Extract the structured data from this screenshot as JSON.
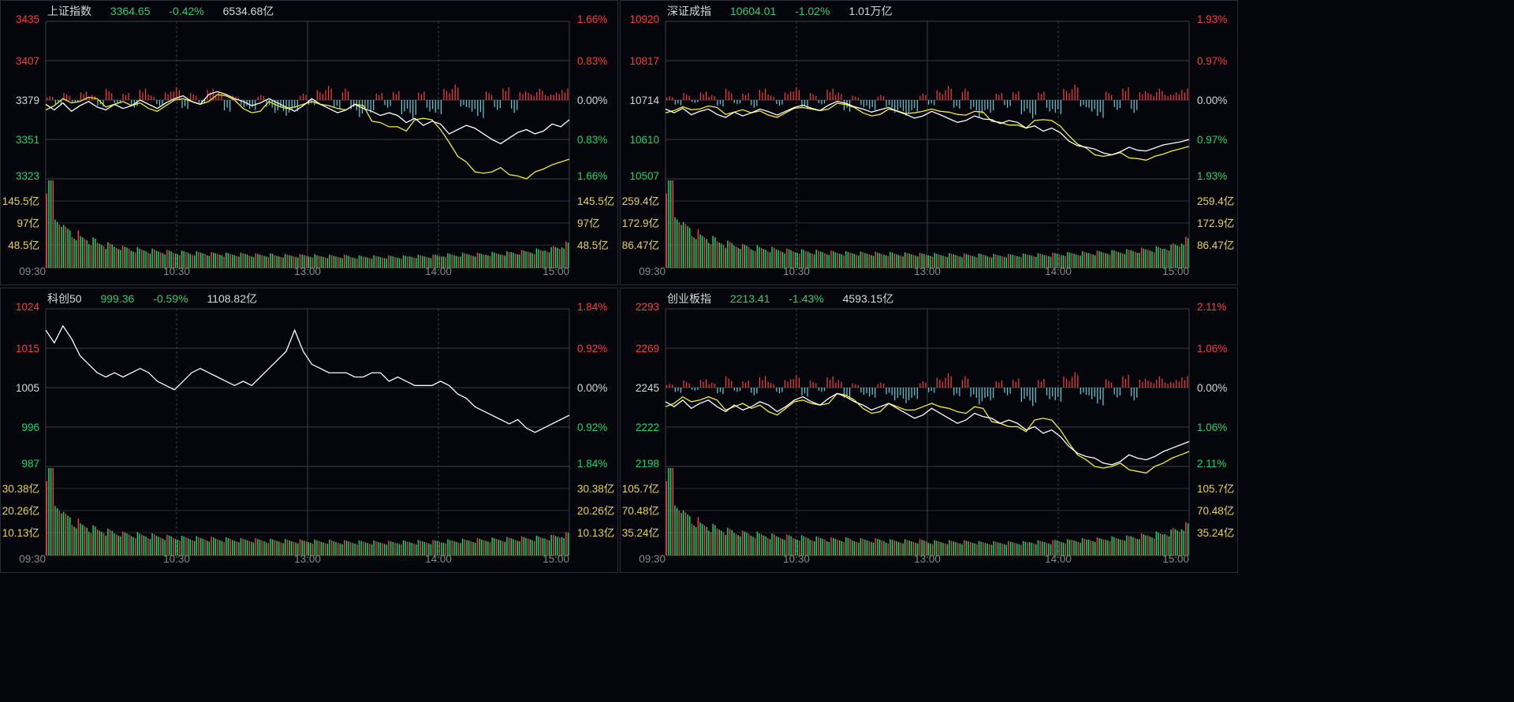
{
  "colors": {
    "up": "#ff3b3b",
    "down": "#16d86b",
    "neutral": "#d8d8d8",
    "avg_line": "#f2ee2a",
    "price_line": "#ffffff",
    "vol_label": "#e8d34a",
    "bar_neg": "#5fd3dc"
  },
  "time_ticks": [
    "09:30",
    "10:30",
    "13:00",
    "14:00",
    "15:00"
  ],
  "chart_data": [
    {
      "type": "line",
      "name": "上证指数",
      "price": "3364.65",
      "change": "-0.42%",
      "turnover": "6534.68亿",
      "price_axis": [
        {
          "label": "3435",
          "color": "up"
        },
        {
          "label": "3407",
          "color": "up"
        },
        {
          "label": "3379",
          "color": "neutral"
        },
        {
          "label": "3351",
          "color": "down"
        },
        {
          "label": "3323",
          "color": "down"
        }
      ],
      "pct_axis": [
        {
          "label": "1.66%",
          "color": "up"
        },
        {
          "label": "0.83%",
          "color": "up"
        },
        {
          "label": "0.00%",
          "color": "neutral"
        },
        {
          "label": "0.83%",
          "color": "down"
        },
        {
          "label": "1.66%",
          "color": "down"
        }
      ],
      "vol_axis": [
        "145.5亿",
        "97亿",
        "48.5亿"
      ],
      "ylim": [
        3323,
        3435
      ],
      "has_avg": true,
      "price_series": [
        3376,
        3372,
        3377,
        3371,
        3375,
        3378,
        3374,
        3372,
        3376,
        3373,
        3375,
        3379,
        3376,
        3373,
        3377,
        3380,
        3382,
        3378,
        3376,
        3383,
        3385,
        3383,
        3380,
        3378,
        3375,
        3377,
        3380,
        3377,
        3374,
        3371,
        3375,
        3380,
        3376,
        3373,
        3370,
        3372,
        3376,
        3373,
        3371,
        3368,
        3370,
        3368,
        3363,
        3366,
        3361,
        3364,
        3362,
        3355,
        3358,
        3361,
        3359,
        3355,
        3351,
        3348,
        3352,
        3356,
        3358,
        3355,
        3357,
        3362,
        3360,
        3365
      ],
      "avg_series": [
        3372,
        3375,
        3380,
        3377,
        3378,
        3381,
        3380,
        3374,
        3376,
        3378,
        3375,
        3377,
        3373,
        3371,
        3375,
        3379,
        3380,
        3378,
        3376,
        3378,
        3383,
        3382,
        3379,
        3373,
        3370,
        3371,
        3378,
        3375,
        3373,
        3374,
        3376,
        3378,
        3376,
        3375,
        3373,
        3372,
        3376,
        3375,
        3364,
        3363,
        3360,
        3360,
        3357,
        3365,
        3366,
        3365,
        3358,
        3349,
        3339,
        3335,
        3328,
        3327,
        3328,
        3331,
        3326,
        3325,
        3323,
        3328,
        3330,
        3333,
        3335,
        3337
      ],
      "dev_bars": [
        0.3,
        -0.4,
        0.5,
        -0.2,
        0.6,
        0.4,
        -0.5,
        0.8,
        -0.3,
        0.5,
        -0.6,
        0.9,
        0.4,
        -0.4,
        0.6,
        1.0,
        -0.7,
        0.5,
        -0.3,
        0.8,
        0.6,
        -0.9,
        0.3,
        -0.5,
        -0.7,
        0.4,
        -0.6,
        -0.9,
        -1.1,
        -0.8,
        0.5,
        -0.4,
        0.7,
        1.0,
        -0.6,
        0.9,
        -0.8,
        -1.2,
        -0.9,
        0.5,
        -0.6,
        0.7,
        -1.0,
        -1.3,
        0.6,
        -0.9,
        -1.1,
        0.8,
        1.1,
        -0.5,
        -0.9,
        -1.4,
        0.6,
        -0.7,
        0.9,
        -1.0,
        0.7,
        0.5,
        0.8,
        0.4,
        0.6,
        0.9
      ],
      "volume": [
        145,
        80,
        62,
        54,
        48,
        44,
        40,
        37,
        35,
        32,
        30,
        29,
        28,
        27,
        26,
        25,
        25,
        24,
        24,
        23,
        23,
        22,
        22,
        22,
        21,
        21,
        21,
        20,
        20,
        20,
        20,
        20,
        19,
        19,
        19,
        19,
        18,
        18,
        18,
        18,
        18,
        18,
        18,
        19,
        19,
        19,
        20,
        21,
        21,
        22,
        22,
        22,
        23,
        23,
        24,
        25,
        26,
        27,
        28,
        30,
        33,
        38
      ]
    },
    {
      "type": "line",
      "name": "深证成指",
      "price": "10604.01",
      "change": "-1.02%",
      "turnover": "1.01万亿",
      "price_axis": [
        {
          "label": "10920",
          "color": "up"
        },
        {
          "label": "10817",
          "color": "up"
        },
        {
          "label": "10714",
          "color": "neutral"
        },
        {
          "label": "10610",
          "color": "down"
        },
        {
          "label": "10507",
          "color": "down"
        }
      ],
      "pct_axis": [
        {
          "label": "1.93%",
          "color": "up"
        },
        {
          "label": "0.97%",
          "color": "up"
        },
        {
          "label": "0.00%",
          "color": "neutral"
        },
        {
          "label": "0.97%",
          "color": "down"
        },
        {
          "label": "1.93%",
          "color": "down"
        }
      ],
      "vol_axis": [
        "259.4亿",
        "172.9亿",
        "86.47亿"
      ],
      "ylim": [
        10507,
        10920
      ],
      "has_avg": true,
      "price_series": [
        10690,
        10680,
        10692,
        10675,
        10684,
        10690,
        10676,
        10668,
        10682,
        10672,
        10680,
        10690,
        10683,
        10674,
        10684,
        10694,
        10700,
        10692,
        10686,
        10700,
        10710,
        10705,
        10696,
        10690,
        10682,
        10688,
        10694,
        10684,
        10676,
        10666,
        10672,
        10684,
        10675,
        10665,
        10655,
        10660,
        10672,
        10664,
        10662,
        10652,
        10660,
        10655,
        10640,
        10646,
        10632,
        10640,
        10628,
        10606,
        10594,
        10590,
        10585,
        10575,
        10570,
        10578,
        10590,
        10582,
        10580,
        10588,
        10596,
        10600,
        10604,
        10610
      ],
      "avg_series": [
        10680,
        10686,
        10696,
        10688,
        10690,
        10698,
        10694,
        10676,
        10682,
        10688,
        10680,
        10685,
        10674,
        10668,
        10680,
        10692,
        10694,
        10690,
        10686,
        10690,
        10705,
        10702,
        10694,
        10680,
        10672,
        10676,
        10690,
        10685,
        10678,
        10680,
        10684,
        10690,
        10684,
        10682,
        10676,
        10674,
        10684,
        10682,
        10658,
        10655,
        10648,
        10648,
        10640,
        10660,
        10662,
        10660,
        10645,
        10620,
        10598,
        10588,
        10570,
        10566,
        10570,
        10576,
        10562,
        10560,
        10556,
        10566,
        10572,
        10580,
        10586,
        10592
      ],
      "dev_bars": [
        0.3,
        -0.4,
        0.5,
        -0.2,
        0.6,
        0.4,
        -0.5,
        0.8,
        -0.3,
        0.5,
        -0.6,
        0.9,
        0.4,
        -0.4,
        0.6,
        1.0,
        -0.7,
        0.5,
        -0.3,
        0.8,
        0.6,
        -0.9,
        0.3,
        -0.5,
        -0.7,
        0.4,
        -0.6,
        -0.9,
        -1.1,
        -0.8,
        0.5,
        -0.4,
        0.7,
        1.0,
        -0.6,
        0.9,
        -0.8,
        -1.2,
        -0.9,
        0.5,
        -0.6,
        0.7,
        -1.0,
        -1.3,
        0.6,
        -0.9,
        -1.1,
        0.8,
        1.1,
        -0.5,
        -0.9,
        -1.4,
        0.6,
        -0.7,
        0.9,
        -1.0,
        0.7,
        0.5,
        0.8,
        0.4,
        0.6,
        0.9
      ],
      "volume": [
        259,
        150,
        118,
        100,
        90,
        82,
        75,
        70,
        66,
        62,
        58,
        56,
        54,
        52,
        50,
        49,
        48,
        47,
        46,
        45,
        44,
        43,
        43,
        42,
        42,
        41,
        41,
        40,
        40,
        40,
        39,
        39,
        38,
        38,
        38,
        37,
        37,
        37,
        36,
        36,
        36,
        37,
        37,
        38,
        38,
        39,
        40,
        41,
        42,
        43,
        44,
        45,
        46,
        47,
        48,
        50,
        52,
        54,
        56,
        60,
        66,
        80
      ]
    },
    {
      "type": "line",
      "name": "科创50",
      "price": "999.36",
      "change": "-0.59%",
      "turnover": "1108.82亿",
      "price_axis": [
        {
          "label": "1024",
          "color": "up"
        },
        {
          "label": "1015",
          "color": "up"
        },
        {
          "label": "1005",
          "color": "neutral"
        },
        {
          "label": "996",
          "color": "down"
        },
        {
          "label": "987",
          "color": "down"
        }
      ],
      "pct_axis": [
        {
          "label": "1.84%",
          "color": "up"
        },
        {
          "label": "0.92%",
          "color": "up"
        },
        {
          "label": "0.00%",
          "color": "neutral"
        },
        {
          "label": "0.92%",
          "color": "down"
        },
        {
          "label": "1.84%",
          "color": "down"
        }
      ],
      "vol_axis": [
        "30.38亿",
        "20.26亿",
        "10.13亿"
      ],
      "ylim": [
        987,
        1024
      ],
      "has_avg": false,
      "price_series": [
        1019,
        1016,
        1020,
        1017,
        1013,
        1011,
        1009,
        1008,
        1009,
        1008,
        1009,
        1010,
        1009,
        1007,
        1006,
        1005,
        1007,
        1009,
        1010,
        1009,
        1008,
        1007,
        1006,
        1007,
        1006,
        1008,
        1010,
        1012,
        1014,
        1019,
        1014,
        1011,
        1010,
        1009,
        1009,
        1009,
        1008,
        1008,
        1009,
        1009,
        1007,
        1008,
        1007,
        1006,
        1006,
        1006,
        1007,
        1006,
        1004,
        1003,
        1001,
        1000,
        999,
        998,
        997,
        998,
        996,
        995,
        996,
        997,
        998,
        999
      ],
      "avg_series": [],
      "dev_bars": [],
      "volume": [
        30,
        17,
        13,
        11,
        10,
        9,
        8.5,
        8,
        7.6,
        7.2,
        7,
        6.8,
        6.6,
        6.4,
        6.2,
        6,
        5.9,
        5.8,
        5.7,
        5.6,
        5.5,
        5.4,
        5.3,
        5.2,
        5.2,
        5.1,
        5,
        5,
        4.9,
        4.9,
        4.8,
        4.8,
        4.7,
        4.7,
        4.6,
        4.6,
        4.5,
        4.5,
        4.5,
        4.4,
        4.4,
        4.4,
        4.5,
        4.5,
        4.6,
        4.6,
        4.7,
        4.8,
        4.9,
        5,
        5.1,
        5.2,
        5.3,
        5.4,
        5.5,
        5.6,
        5.7,
        5.8,
        5.9,
        6.1,
        6.4,
        7
      ]
    },
    {
      "type": "line",
      "name": "创业板指",
      "price": "2213.41",
      "change": "-1.43%",
      "turnover": "4593.15亿",
      "price_axis": [
        {
          "label": "2293",
          "color": "up"
        },
        {
          "label": "2269",
          "color": "up"
        },
        {
          "label": "2245",
          "color": "neutral"
        },
        {
          "label": "2222",
          "color": "down"
        },
        {
          "label": "2198",
          "color": "down"
        }
      ],
      "pct_axis": [
        {
          "label": "2.11%",
          "color": "up"
        },
        {
          "label": "1.06%",
          "color": "up"
        },
        {
          "label": "0.00%",
          "color": "neutral"
        },
        {
          "label": "1.06%",
          "color": "down"
        },
        {
          "label": "2.11%",
          "color": "down"
        }
      ],
      "vol_axis": [
        "105.7亿",
        "70.48亿",
        "35.24亿"
      ],
      "ylim": [
        2198,
        2293
      ],
      "has_avg": true,
      "price_series": [
        2237,
        2234,
        2238,
        2233,
        2236,
        2238,
        2234,
        2231,
        2235,
        2232,
        2234,
        2237,
        2235,
        2231,
        2234,
        2238,
        2240,
        2237,
        2235,
        2239,
        2242,
        2240,
        2237,
        2235,
        2232,
        2234,
        2236,
        2233,
        2230,
        2227,
        2229,
        2233,
        2230,
        2227,
        2224,
        2226,
        2230,
        2228,
        2227,
        2224,
        2226,
        2224,
        2220,
        2222,
        2218,
        2220,
        2216,
        2210,
        2206,
        2204,
        2203,
        2200,
        2199,
        2201,
        2205,
        2203,
        2202,
        2204,
        2207,
        2209,
        2211,
        2213
      ],
      "avg_series": [
        2234,
        2236,
        2240,
        2237,
        2238,
        2240,
        2238,
        2232,
        2234,
        2236,
        2233,
        2235,
        2231,
        2229,
        2233,
        2237,
        2238,
        2236,
        2235,
        2236,
        2242,
        2241,
        2238,
        2233,
        2230,
        2231,
        2236,
        2234,
        2232,
        2232,
        2234,
        2236,
        2234,
        2233,
        2231,
        2230,
        2234,
        2233,
        2225,
        2224,
        2222,
        2222,
        2219,
        2226,
        2227,
        2226,
        2220,
        2212,
        2205,
        2202,
        2198,
        2197,
        2198,
        2200,
        2196,
        2195,
        2194,
        2198,
        2200,
        2203,
        2205,
        2207
      ],
      "dev_bars": [
        0.3,
        -0.4,
        0.5,
        -0.2,
        0.6,
        0.4,
        -0.5,
        0.8,
        -0.3,
        0.5,
        -0.6,
        0.9,
        0.4,
        -0.4,
        0.6,
        1.0,
        -0.7,
        0.5,
        -0.3,
        0.8,
        0.6,
        -0.9,
        0.3,
        -0.5,
        -0.7,
        0.4,
        -0.6,
        -0.9,
        -1.1,
        -0.8,
        0.5,
        -0.4,
        0.7,
        1.0,
        -0.6,
        0.9,
        -0.8,
        -1.2,
        -0.9,
        0.5,
        -0.6,
        0.7,
        -1.0,
        -1.3,
        0.6,
        -0.9,
        -1.1,
        0.8,
        1.1,
        -0.5,
        -0.9,
        -1.4,
        0.6,
        -0.7,
        0.9,
        -1.0,
        0.7,
        0.5,
        0.8,
        0.4,
        0.6,
        0.9
      ],
      "volume": [
        105,
        60,
        47,
        40,
        36,
        33,
        31,
        29,
        27,
        26,
        25,
        24,
        23,
        22,
        22,
        21,
        21,
        20,
        20,
        19,
        19,
        19,
        18,
        18,
        18,
        18,
        17,
        17,
        17,
        17,
        17,
        16,
        16,
        16,
        16,
        16,
        16,
        15,
        15,
        15,
        15,
        15,
        15,
        16,
        16,
        16,
        17,
        17,
        18,
        18,
        19,
        19,
        20,
        20,
        21,
        22,
        23,
        24,
        25,
        27,
        30,
        35
      ]
    }
  ]
}
